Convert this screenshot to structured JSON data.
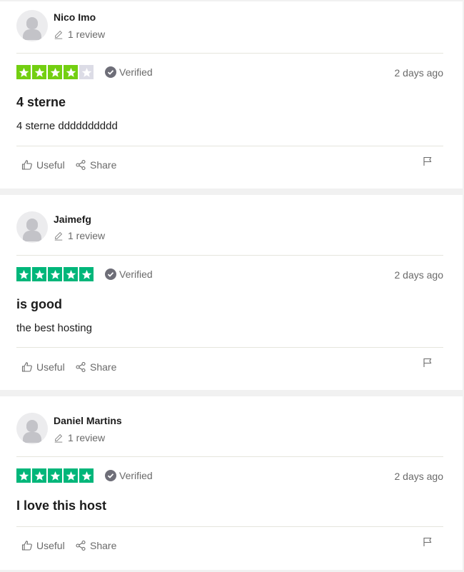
{
  "colors": {
    "star_green": "#00b67a",
    "star_lightgreen": "#73cf11",
    "star_empty": "#dcdce6",
    "verified_badge": "#6e6e78"
  },
  "reviews": [
    {
      "name": "Nico Imo",
      "review_count": "1 review",
      "rating": 4,
      "verified": "Verified",
      "date": "2 days ago",
      "title": "4 sterne",
      "text": "4 sterne dddddddddd",
      "useful": "Useful",
      "share": "Share"
    },
    {
      "name": "Jaimefg",
      "review_count": "1 review",
      "rating": 5,
      "verified": "Verified",
      "date": "2 days ago",
      "title": "is good",
      "text": "the best hosting",
      "useful": "Useful",
      "share": "Share"
    },
    {
      "name": "Daniel Martins",
      "review_count": "1 review",
      "rating": 5,
      "verified": "Verified",
      "date": "2 days ago",
      "title": "I love this host",
      "text": "",
      "useful": "Useful",
      "share": "Share"
    }
  ]
}
